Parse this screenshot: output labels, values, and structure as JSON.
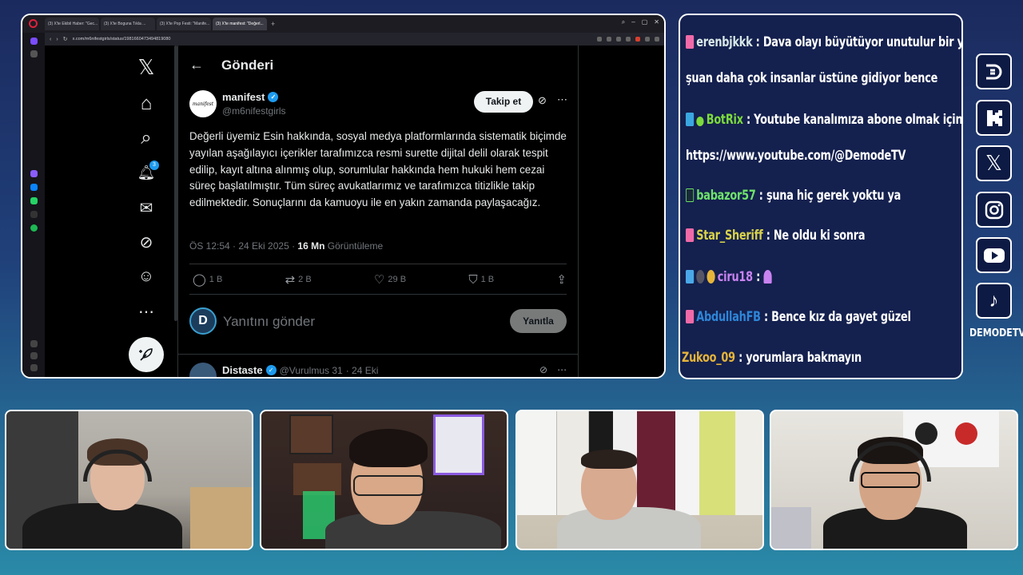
{
  "browser": {
    "tabs": [
      {
        "label": "(3) X'te Ekibil Haber: \"Gec...",
        "active": false
      },
      {
        "label": "(3) X'te Boguna Tıkla ...",
        "active": false
      },
      {
        "label": "(3) X'te Pop Festi: \"Manife...",
        "active": false
      },
      {
        "label": "(3) X'te manifest: \"Değerl...",
        "active": true
      }
    ],
    "new_tab": "+",
    "url": "x.com/m6nifestgirls/status/1981660473494819080"
  },
  "twitter": {
    "nav_items": [
      {
        "name": "x-logo-icon",
        "glyph": "𝕏"
      },
      {
        "name": "home-icon",
        "glyph": "⌂"
      },
      {
        "name": "search-icon",
        "glyph": "⌕"
      },
      {
        "name": "notifications-icon",
        "glyph": "🔔︎"
      },
      {
        "name": "messages-icon",
        "glyph": "✉"
      },
      {
        "name": "grok-icon",
        "glyph": "⊘"
      },
      {
        "name": "profile-icon",
        "glyph": "☺"
      },
      {
        "name": "more-icon",
        "glyph": "⋯"
      }
    ],
    "notification_count": "3",
    "page_title": "Gönderi",
    "author": {
      "name": "manifest",
      "handle": "@m6nifestgirls",
      "avatar_text": "manifest"
    },
    "follow_label": "Takip et",
    "tweet_text": "Değerli üyemiz Esin hakkında, sosyal medya platformlarında sistematik biçimde yayılan aşağılayıcı içerikler tarafımızca resmi surette dijital delil olarak tespit edilip, kayıt altına alınmış olup, sorumlular hakkında hem hukuki hem cezai süreç başlatılmıştır. Tüm süreç avukatlarımız ve tarafımızca titizlikle takip edilmektedir. Sonuçlarını da kamuoyu ile en yakın zamanda paylaşacağız.",
    "meta_time": "ÖS 12:54 · 24 Eki 2025 · ",
    "meta_views": "16 Mn",
    "meta_views_label": " Görüntüleme",
    "actions": [
      {
        "name": "reply",
        "glyph": "◯",
        "count": "1 B"
      },
      {
        "name": "retweet",
        "glyph": "⇄",
        "count": "2 B"
      },
      {
        "name": "like",
        "glyph": "♡",
        "count": "29 B"
      },
      {
        "name": "bookmark",
        "glyph": "⛉",
        "count": "1 B"
      },
      {
        "name": "share",
        "glyph": "⇪",
        "count": ""
      }
    ],
    "reply_placeholder": "Yanıtını gönder",
    "reply_button": "Yanıtla",
    "next_post": {
      "name": "Distaste",
      "handle": "@Vurulmus 31",
      "time": "· 24 Eki"
    }
  },
  "chat": {
    "messages": [
      {
        "icon_color": "#f06aa8",
        "user": "erenbjkkk",
        "user_color": "#e8e8e8",
        "text": " : Dava olayı büyütüyor unutulur bir yerde"
      },
      {
        "icon_color": "",
        "user": "",
        "user_color": "#ffffff",
        "text": "şuan daha çok insanlar üstüne gidiyor bence"
      },
      {
        "icon_color": "#3aa7e0",
        "user": "BotRix",
        "user_color": "#7cdb3c",
        "text": " : Youtube kanalımıza abone olmak için:"
      },
      {
        "icon_color": "",
        "user": "",
        "user_color": "#ffffff",
        "text": "https://www.youtube.com/@DemodeTV"
      },
      {
        "icon_color": "#1a2a3a",
        "user": "babazor57",
        "user_color": "#6ee36a",
        "text": " : şuna hiç gerek yoktu ya"
      },
      {
        "icon_color": "#f06aa8",
        "user": "Star_Sheriff",
        "user_color": "#d9d24a",
        "text": " : Ne oldu ki sonra"
      },
      {
        "icon_color": "#4aa8e8",
        "user": "ciru18",
        "user_color": "#c983f0",
        "text": " : "
      },
      {
        "icon_color": "#f06aa8",
        "user": "AbdullahFB",
        "user_color": "#2e86d8",
        "text": " : Bence kız da gayet güzel"
      },
      {
        "icon_color": "",
        "user": "Zukoo_09",
        "user_color": "#e6b43a",
        "text": " : yorumlara bakmayın"
      }
    ]
  },
  "social": {
    "icons": [
      {
        "name": "kick-d-icon",
        "glyph": "D"
      },
      {
        "name": "kick-k-icon",
        "glyph": "K"
      },
      {
        "name": "x-icon",
        "glyph": "𝕏"
      },
      {
        "name": "instagram-icon",
        "glyph": "◎"
      },
      {
        "name": "youtube-icon",
        "glyph": "▶"
      },
      {
        "name": "tiktok-icon",
        "glyph": "♪"
      }
    ],
    "brand": "DEMODETV"
  },
  "colors": {
    "accent": "#1d9bf0",
    "border": "#ffffff",
    "bg_top": "#1b2a5e",
    "bg_bottom": "#2a8aa8"
  }
}
